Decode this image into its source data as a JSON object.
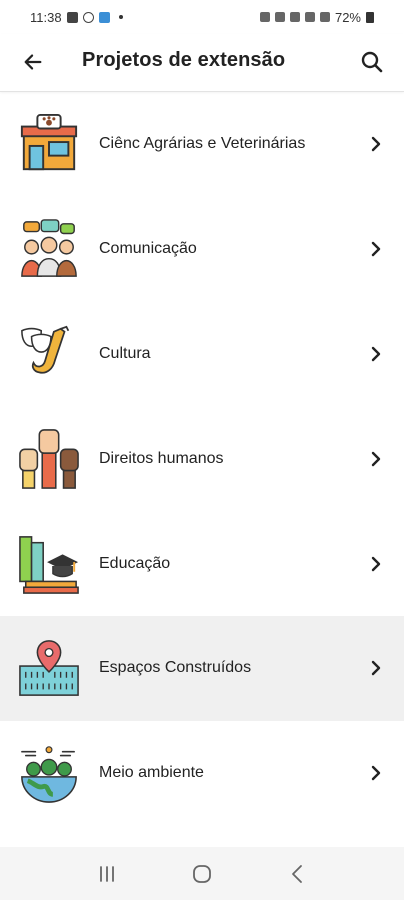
{
  "status_bar": {
    "time": "11:38",
    "battery": "72%"
  },
  "app_bar": {
    "title": "Projetos de extensão",
    "back_icon": "arrow-left-icon",
    "search_icon": "search-icon"
  },
  "categories": [
    {
      "label": "Ciênc Agrárias e Veterinárias",
      "icon": "vet-clinic-icon"
    },
    {
      "label": "Comunicação",
      "icon": "communication-people-icon"
    },
    {
      "label": "Cultura",
      "icon": "theater-masks-saxophone-icon"
    },
    {
      "label": "Direitos humanos",
      "icon": "raised-fists-icon"
    },
    {
      "label": "Educação",
      "icon": "books-graduation-cap-icon"
    },
    {
      "label": "Espaços Construídos",
      "icon": "building-location-pin-icon"
    },
    {
      "label": "Meio ambiente",
      "icon": "earth-trees-icon"
    }
  ],
  "highlighted_index": 5,
  "nav_bar": {
    "recents_icon": "recents-icon",
    "home_icon": "home-circle-icon",
    "back_icon": "nav-back-icon"
  }
}
